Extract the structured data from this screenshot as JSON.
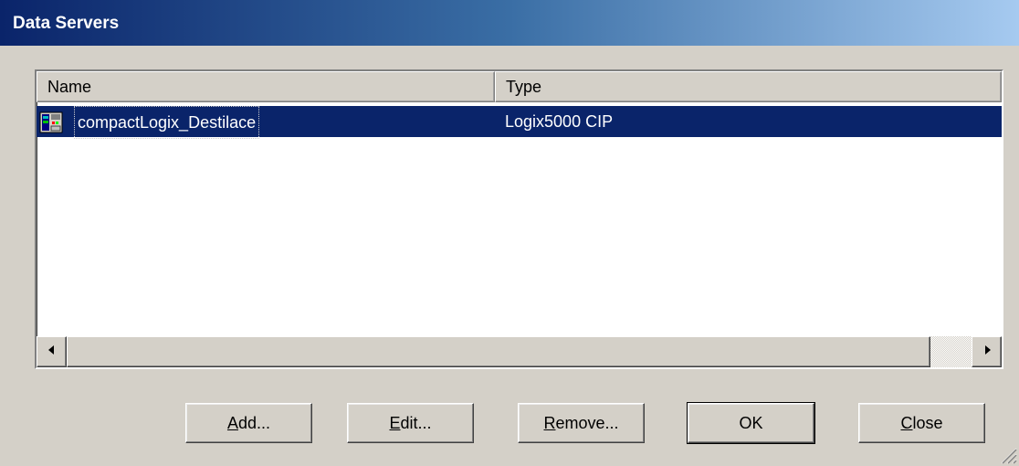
{
  "window": {
    "title": "Data Servers"
  },
  "list": {
    "columns": [
      {
        "label": "Name"
      },
      {
        "label": "Type"
      }
    ],
    "rows": [
      {
        "name": "compactLogix_Destilace",
        "type": "Logix5000 CIP",
        "icon": "plc-server-icon",
        "selected": true
      }
    ]
  },
  "buttons": {
    "add": {
      "mnemonic": "A",
      "rest": "dd..."
    },
    "edit": {
      "mnemonic": "E",
      "rest": "dit..."
    },
    "remove": {
      "mnemonic": "R",
      "rest": "emove..."
    },
    "ok": {
      "label": "OK"
    },
    "close": {
      "mnemonic": "C",
      "rest": "lose"
    }
  },
  "colors": {
    "face": "#d4d0c8",
    "title_start": "#0a246a",
    "title_end": "#a6caf0",
    "selection": "#0a246a"
  }
}
